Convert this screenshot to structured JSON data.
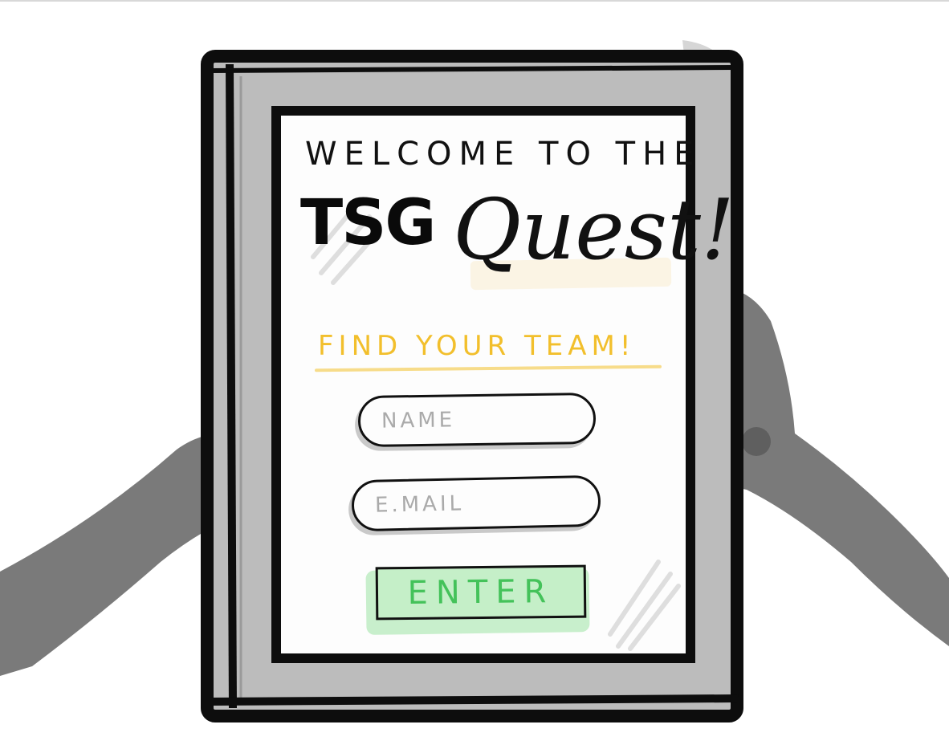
{
  "welcome_text": "WELCOME TO THE",
  "title": {
    "brand": "TSG",
    "word": "Quest!"
  },
  "tagline": "FIND YOUR TEAM!",
  "form": {
    "name_placeholder": "NAME",
    "email_placeholder": "E.MAIL",
    "enter_label": "ENTER"
  },
  "colors": {
    "tagline": "#f2bf2c",
    "enter_fill": "#c5efc8",
    "enter_text": "#44c25a",
    "frame": "#111111",
    "bezel": "#bdbdbd",
    "hands": "#7a7a7a"
  }
}
